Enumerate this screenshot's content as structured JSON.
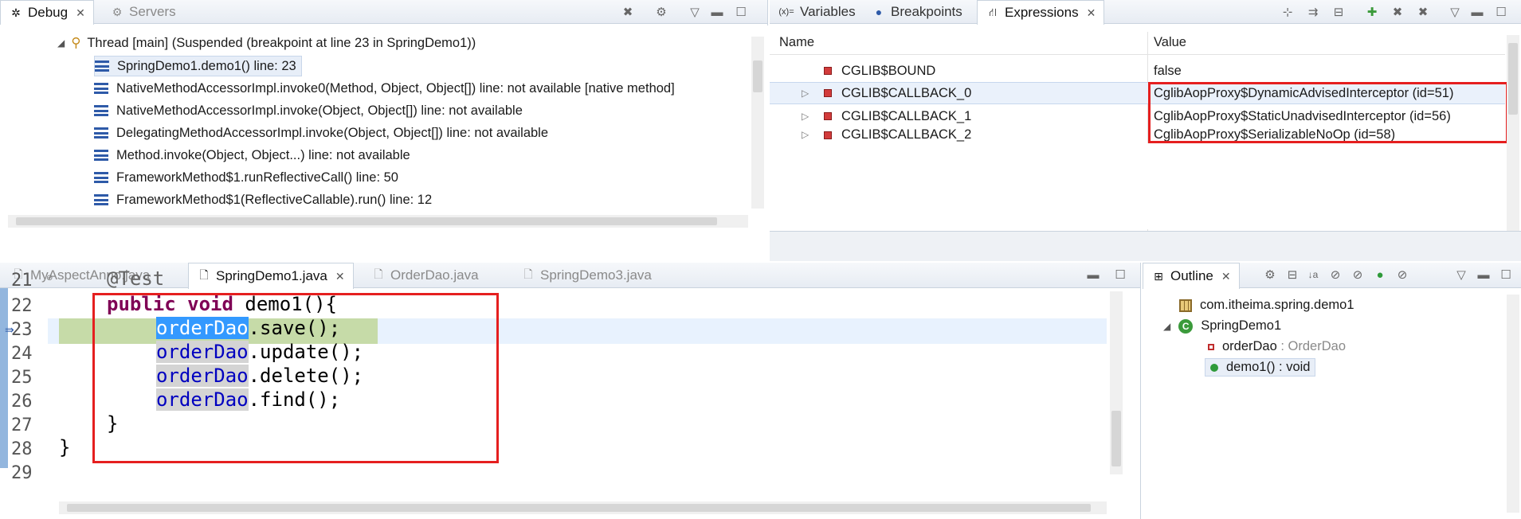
{
  "debug_view": {
    "tabs": [
      {
        "label": "Debug",
        "icon": "debug-bug-icon",
        "active": true
      },
      {
        "label": "Servers",
        "icon": "servers-icon",
        "active": false
      }
    ],
    "thread": "Thread [main] (Suspended (breakpoint at line 23 in SpringDemo1))",
    "frames": [
      "SpringDemo1.demo1() line: 23",
      "NativeMethodAccessorImpl.invoke0(Method, Object, Object[]) line: not available [native method]",
      "NativeMethodAccessorImpl.invoke(Object, Object[]) line: not available",
      "DelegatingMethodAccessorImpl.invoke(Object, Object[]) line: not available",
      "Method.invoke(Object, Object...) line: not available",
      "FrameworkMethod$1.runReflectiveCall() line: 50",
      "FrameworkMethod$1(ReflectiveCallable).run() line: 12"
    ]
  },
  "expressions_view": {
    "tabs": [
      {
        "label": "Variables",
        "icon": "variables-icon",
        "active": false
      },
      {
        "label": "Breakpoints",
        "icon": "breakpoints-icon",
        "active": false
      },
      {
        "label": "Expressions",
        "icon": "expressions-icon",
        "active": true
      }
    ],
    "columns": {
      "name": "Name",
      "value": "Value"
    },
    "rows": [
      {
        "name": "CGLIB$BOUND",
        "value": "false",
        "expandable": false
      },
      {
        "name": "CGLIB$CALLBACK_0",
        "value": "CglibAopProxy$DynamicAdvisedInterceptor  (id=51)",
        "expandable": true
      },
      {
        "name": "CGLIB$CALLBACK_1",
        "value": "CglibAopProxy$StaticUnadvisedInterceptor  (id=56)",
        "expandable": true
      },
      {
        "name": "CGLIB$CALLBACK_2",
        "value": "CglibAopProxy$SerializableNoOp  (id=58)",
        "expandable": true
      }
    ]
  },
  "editor": {
    "tabs": [
      {
        "label": "MyAspectAnno.java",
        "active": false
      },
      {
        "label": "SpringDemo1.java",
        "active": true
      },
      {
        "label": "OrderDao.java",
        "active": false
      },
      {
        "label": "SpringDemo3.java",
        "active": false
      }
    ],
    "line_numbers": [
      "21",
      "22",
      "23",
      "24",
      "25",
      "26",
      "27",
      "28",
      "29"
    ],
    "code": {
      "l21": "@Test",
      "l22_kw1": "public",
      "l22_kw2": "void",
      "l22_rest": " demo1(){",
      "var": "orderDao",
      "l23_rest": ".save();",
      "l24_rest": ".update();",
      "l25_rest": ".delete();",
      "l26_rest": ".find();",
      "l27": "}",
      "l28": "}"
    }
  },
  "outline_view": {
    "tab": "Outline",
    "package": "com.itheima.spring.demo1",
    "class": "SpringDemo1",
    "field_name": "orderDao",
    "field_type": " : OrderDao",
    "method": "demo1() : void"
  },
  "colors": {
    "highlight_box": "#e51f1f",
    "keyword": "#7f0055",
    "field": "#0000c0",
    "debug_line": "#c6dba8"
  }
}
